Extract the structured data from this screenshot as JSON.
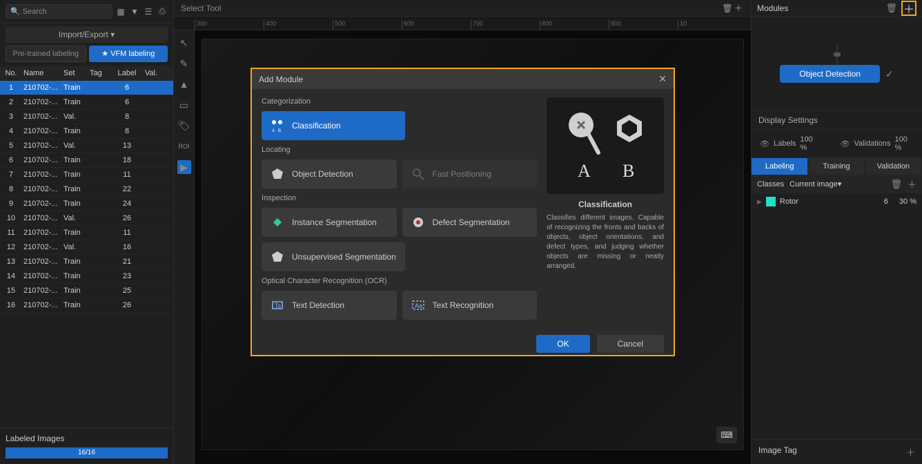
{
  "left": {
    "search_placeholder": "Search",
    "import_export": "Import/Export ▾",
    "pretrained_label": "Pre-trained labeling",
    "vfm_label": "VFM labeling",
    "columns": {
      "no": "No.",
      "name": "Name",
      "set": "Set",
      "tag": "Tag",
      "label": "Label",
      "val": "Val."
    },
    "rows": [
      {
        "no": "1",
        "name": "210702-...",
        "set": "Train",
        "tag": "",
        "label": "6",
        "val": ""
      },
      {
        "no": "2",
        "name": "210702-...",
        "set": "Train",
        "tag": "",
        "label": "6",
        "val": ""
      },
      {
        "no": "3",
        "name": "210702-...",
        "set": "Val.",
        "tag": "",
        "label": "8",
        "val": ""
      },
      {
        "no": "4",
        "name": "210702-...",
        "set": "Train",
        "tag": "",
        "label": "8",
        "val": ""
      },
      {
        "no": "5",
        "name": "210702-...",
        "set": "Val.",
        "tag": "",
        "label": "13",
        "val": ""
      },
      {
        "no": "6",
        "name": "210702-...",
        "set": "Train",
        "tag": "",
        "label": "18",
        "val": ""
      },
      {
        "no": "7",
        "name": "210702-...",
        "set": "Train",
        "tag": "",
        "label": "11",
        "val": ""
      },
      {
        "no": "8",
        "name": "210702-...",
        "set": "Train",
        "tag": "",
        "label": "22",
        "val": ""
      },
      {
        "no": "9",
        "name": "210702-...",
        "set": "Train",
        "tag": "",
        "label": "24",
        "val": ""
      },
      {
        "no": "10",
        "name": "210702-...",
        "set": "Val.",
        "tag": "",
        "label": "26",
        "val": ""
      },
      {
        "no": "11",
        "name": "210702-...",
        "set": "Train",
        "tag": "",
        "label": "11",
        "val": ""
      },
      {
        "no": "12",
        "name": "210702-...",
        "set": "Val.",
        "tag": "",
        "label": "16",
        "val": ""
      },
      {
        "no": "13",
        "name": "210702-...",
        "set": "Train",
        "tag": "",
        "label": "21",
        "val": ""
      },
      {
        "no": "14",
        "name": "210702-...",
        "set": "Train",
        "tag": "",
        "label": "23",
        "val": ""
      },
      {
        "no": "15",
        "name": "210702-...",
        "set": "Train",
        "tag": "",
        "label": "25",
        "val": ""
      },
      {
        "no": "16",
        "name": "210702-...",
        "set": "Train",
        "tag": "",
        "label": "26",
        "val": ""
      }
    ],
    "labeled_images": "Labeled Images",
    "progress_text": "16/16"
  },
  "middle": {
    "select_tool": "Select Tool",
    "ruler_ticks": [
      "300",
      "400",
      "500",
      "600",
      "700",
      "800",
      "900",
      "10"
    ],
    "roi": "ROI"
  },
  "right": {
    "modules_title": "Modules",
    "module_name": "Object Detection",
    "display_settings": "Display Settings",
    "labels": "Labels",
    "labels_pct": "100 %",
    "validations": "Validations",
    "validations_pct": "100 %",
    "tabs": {
      "labeling": "Labeling",
      "training": "Training",
      "validation": "Validation"
    },
    "classes": "Classes",
    "current_image": "Current image▾",
    "class_name": "Rotor",
    "class_count": "6",
    "class_pct": "30 %",
    "image_tag": "Image Tag"
  },
  "modal": {
    "title": "Add Module",
    "categorization": "Categorization",
    "classification": "Classification",
    "locating": "Locating",
    "object_detection": "Object Detection",
    "fast_positioning": "Fast Positioning",
    "inspection": "Inspection",
    "instance_seg": "Instance Segmentation",
    "defect_seg": "Defect Segmentation",
    "unsup_seg": "Unsupervised Segmentation",
    "ocr": "Optical Character Recognition (OCR)",
    "text_detection": "Text Detection",
    "text_recognition": "Text Recognition",
    "preview_title": "Classification",
    "preview_desc": "Classifies different images. Capable of recognizing the fronts and backs of objects, object orientations, and defect types, and judging whether objects are missing or neatly arranged.",
    "ok": "OK",
    "cancel": "Cancel",
    "letter_a": "A",
    "letter_b": "B"
  }
}
